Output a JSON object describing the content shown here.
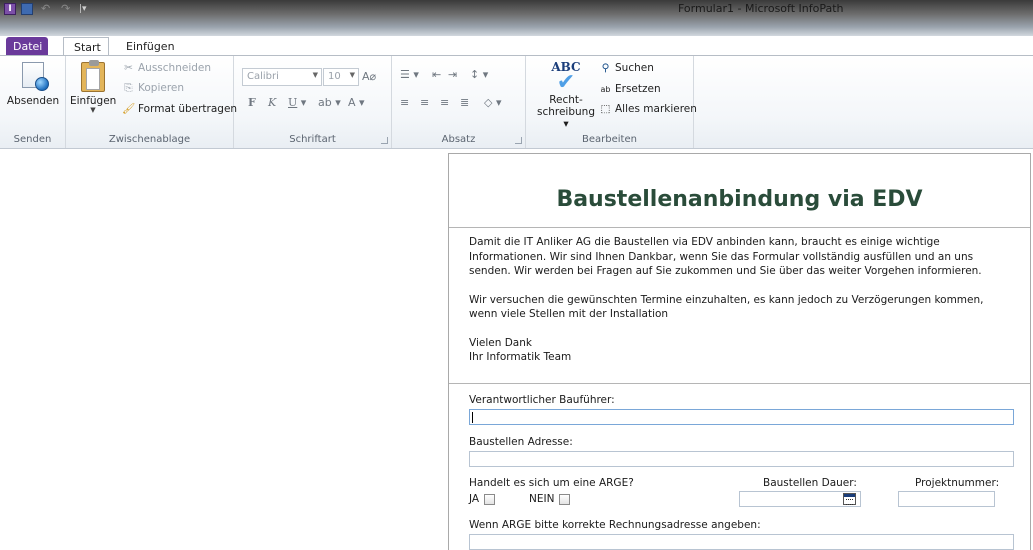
{
  "window": {
    "title": "Formular1 - Microsoft InfoPath",
    "qat": {
      "app_icon": "infopath-icon",
      "save_icon": "save-icon",
      "undo_icon": "undo-icon",
      "redo_icon": "redo-icon",
      "customize_icon": "customize-qat-icon"
    }
  },
  "tabs": [
    {
      "label": "Datei"
    },
    {
      "label": "Start"
    },
    {
      "label": "Einfügen"
    }
  ],
  "ribbon": {
    "senden": {
      "label": "Senden",
      "absenden": "Absenden"
    },
    "zwischenablage": {
      "label": "Zwischenablage",
      "einfuegen": "Einfügen",
      "ausschneiden": "Ausschneiden",
      "kopieren": "Kopieren",
      "format_uebertragen": "Format übertragen"
    },
    "schriftart": {
      "label": "Schriftart",
      "font": "Calibri",
      "size": "10",
      "bold": "F",
      "italic": "K",
      "underline": "U",
      "highlight": "ab",
      "color": "A"
    },
    "absatz": {
      "label": "Absatz"
    },
    "bearbeiten": {
      "label": "Bearbeiten",
      "abc": "ABC",
      "recht": "Recht-",
      "schreibung": "schreibung",
      "suchen": "Suchen",
      "ersetzen": "Ersetzen",
      "alles_markieren": "Alles markieren"
    }
  },
  "form": {
    "title": "Baustellenanbindung via EDV",
    "intro_p1": "Damit die IT Anliker AG die Baustellen via EDV anbinden kann, braucht es einige wichtige Informationen. Wir sind Ihnen Dankbar, wenn Sie das Formular vollständig ausfüllen und an uns senden. Wir werden bei Fragen auf Sie zukommen und Sie über das weiter Vorgehen informieren.",
    "intro_p2": "Wir versuchen die gewünschten Termine einzuhalten, es kann jedoch zu Verzögerungen kommen, wenn viele Stellen mit der Installation",
    "intro_thanks": "Vielen Dank",
    "intro_team": "Ihr Informatik Team",
    "bauf_label": "Verantwortlicher Bauführer:",
    "bauf_value": "",
    "adresse_label": "Baustellen Adresse:",
    "adresse_value": "",
    "arge_label": "Handelt es sich um eine ARGE?",
    "ja_label": "JA",
    "nein_label": "NEIN",
    "dauer_label": "Baustellen Dauer:",
    "dauer_value": "",
    "projekt_label": "Projektnummer:",
    "projekt_value": "",
    "rechnung_label": "Wenn ARGE bitte korrekte Rechnungsadresse angeben:",
    "rechnung_value": ""
  }
}
